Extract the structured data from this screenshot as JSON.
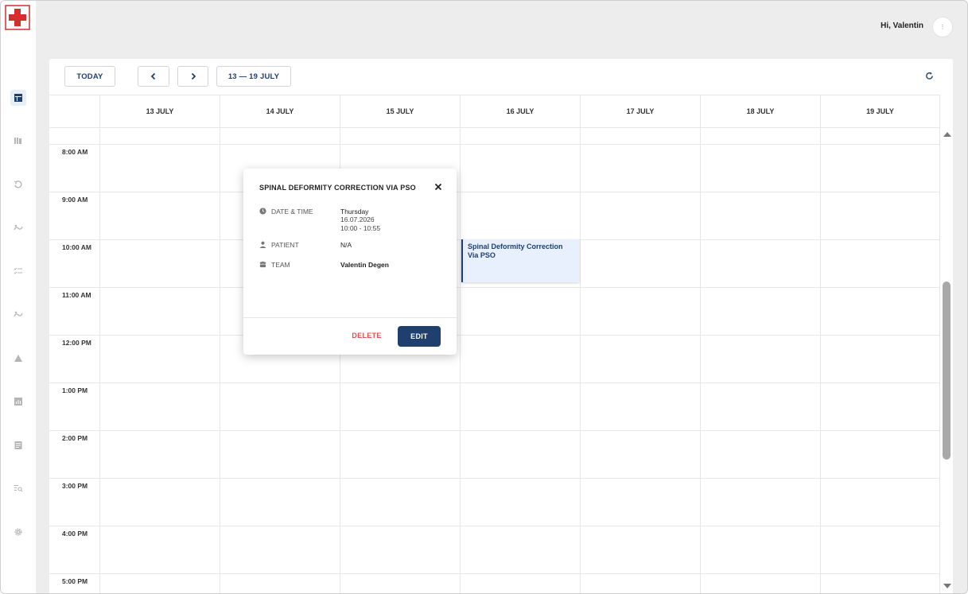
{
  "header": {
    "greeting": "Hi, Valentin"
  },
  "toolbar": {
    "today_label": "TODAY",
    "prev_icon": "chevron-left-icon",
    "next_icon": "chevron-right-icon",
    "range_label": "13 — 19 JULY",
    "refresh_icon": "refresh-icon"
  },
  "sidebar": {
    "items": [
      {
        "icon": "calendar-icon",
        "active": true
      },
      {
        "icon": "library-icon"
      },
      {
        "icon": "history-icon"
      },
      {
        "icon": "procedures-icon"
      },
      {
        "icon": "checklist-icon"
      },
      {
        "icon": "procedures-alt-icon"
      },
      {
        "icon": "warning-icon"
      },
      {
        "icon": "analytics-icon"
      },
      {
        "icon": "document-icon"
      },
      {
        "icon": "search-list-icon"
      },
      {
        "icon": "settings-icon"
      }
    ]
  },
  "calendar": {
    "days": [
      "13 JULY",
      "14 JULY",
      "15 JULY",
      "16 JULY",
      "17 JULY",
      "18 JULY",
      "19 JULY"
    ],
    "times": [
      "8:00 AM",
      "9:00 AM",
      "10:00 AM",
      "11:00 AM",
      "12:00 PM",
      "1:00 PM",
      "2:00 PM",
      "3:00 PM",
      "4:00 PM",
      "5:00 PM"
    ],
    "event": {
      "title": "Spinal Deformity Correction Via PSO",
      "day": "16 JULY",
      "start": "10:00",
      "end": "10:55"
    }
  },
  "popup": {
    "title": "SPINAL DEFORMITY CORRECTION VIA PSO",
    "date_label": "DATE & TIME",
    "date_day": "Thursday",
    "date_value": "16.07.2026",
    "time_value": "10:00 - 10:55",
    "patient_label": "PATIENT",
    "patient_value": "N/A",
    "team_label": "TEAM",
    "team_value": "Valentin Degen",
    "delete_label": "DELETE",
    "edit_label": "EDIT"
  },
  "colors": {
    "primary": "#1f3f6e",
    "danger": "#e05252",
    "event_bg": "#e8f0fd",
    "logo_red": "#d32f2f"
  }
}
